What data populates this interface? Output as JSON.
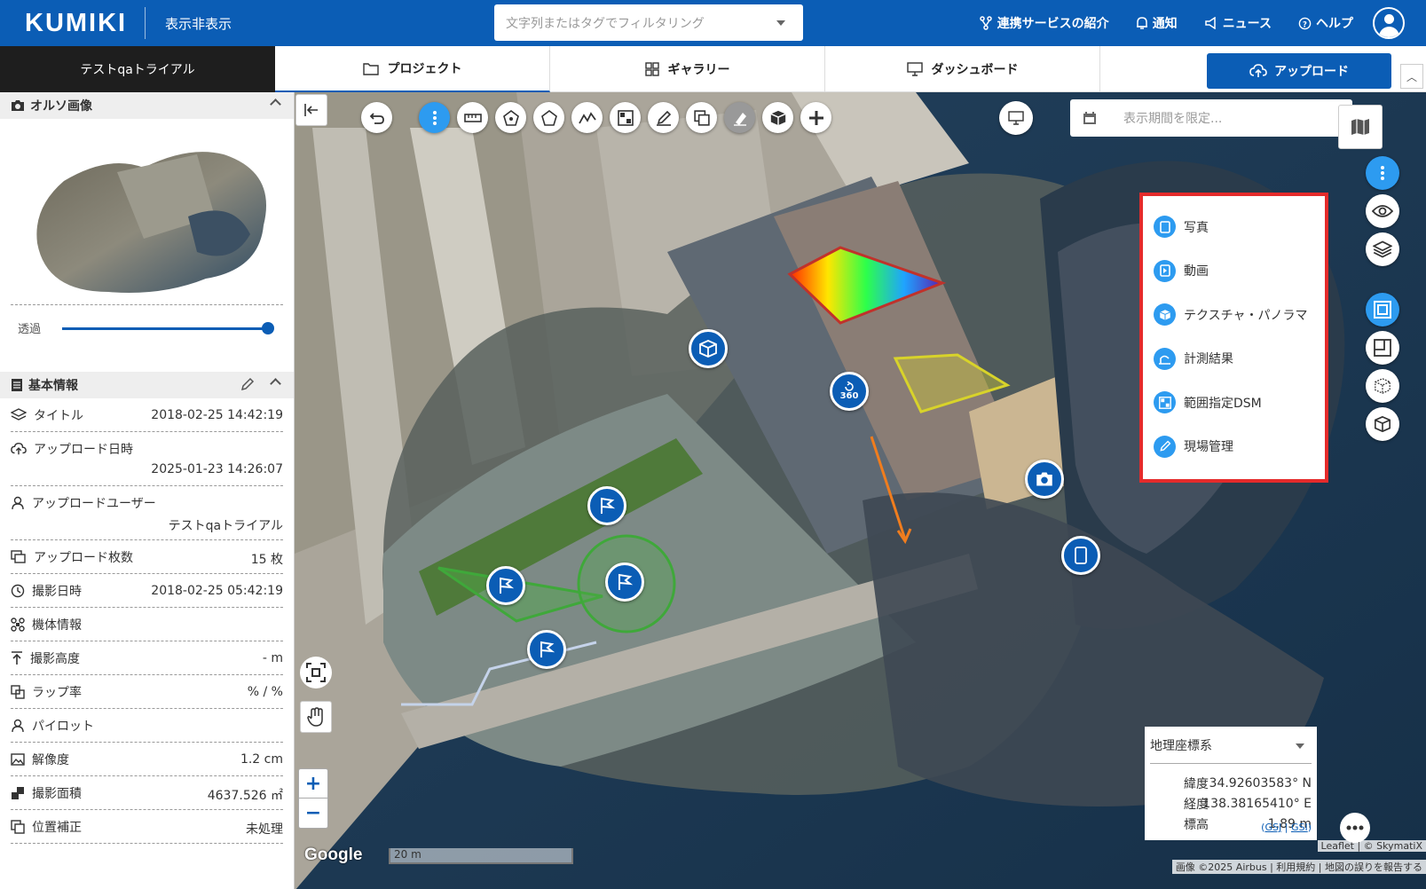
{
  "header": {
    "logo": "KUMIKI",
    "toggle_label": "表示非表示",
    "search_placeholder": "文字列またはタグでフィルタリング",
    "nav": [
      "連携サービスの紹介",
      "通知",
      "ニュース",
      "ヘルプ"
    ]
  },
  "tabs": {
    "project_title": "テストqaトライアル",
    "items": [
      "プロジェクト",
      "ギャラリー",
      "ダッシュボード"
    ],
    "upload_label": "アップロード"
  },
  "sidebar": {
    "ortho_title": "オルソ画像",
    "opacity_label": "透過",
    "opacity_value": 1.0,
    "basic_title": "基本情報",
    "rows": [
      {
        "label": "タイトル",
        "value": "2018-02-25 14:42:19"
      },
      {
        "label": "アップロード日時",
        "value": "2025-01-23 14:26:07"
      },
      {
        "label": "アップロードユーザー",
        "value": "テストqaトライアル"
      },
      {
        "label": "アップロード枚数",
        "value": "15 枚"
      },
      {
        "label": "撮影日時",
        "value": "2018-02-25 05:42:19"
      },
      {
        "label": "機体情報",
        "value": ""
      },
      {
        "label": "撮影高度",
        "value": "- m"
      },
      {
        "label": "ラップ率",
        "value": "% / %"
      },
      {
        "label": "パイロット",
        "value": ""
      },
      {
        "label": "解像度",
        "value": "1.2 cm"
      },
      {
        "label": "撮影面積",
        "value": "4637.526 ㎡"
      },
      {
        "label": "位置補正",
        "value": "未処理"
      }
    ]
  },
  "map": {
    "date_placeholder": "表示期間を限定...",
    "popup_items": [
      "写真",
      "動画",
      "テクスチャ・パノラマ",
      "計測結果",
      "範囲指定DSM",
      "現場管理"
    ],
    "marker_360": "360",
    "coord": {
      "system": "地理座標系",
      "lat_label": "緯度",
      "lat_value": "34.92603583° N",
      "lon_label": "経度",
      "lon_value": "138.38165410° E",
      "alt_label": "標高",
      "alt_value": "1.89 m",
      "links": [
        "GSJ",
        "GSI"
      ]
    },
    "scale_label": "20 m",
    "google": "Google",
    "attribution1": "Leaflet | © SkymatiX",
    "attribution2": "画像 ©2025 Airbus | 利用規約 | 地図の誤りを報告する"
  },
  "colors": {
    "brand": "#0b5db5",
    "accent": "#2d9bf0",
    "highlight": "#e52b2b"
  }
}
